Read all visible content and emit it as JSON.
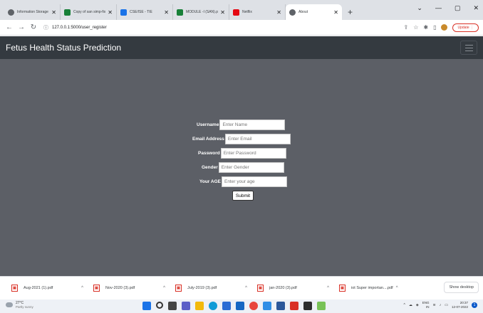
{
  "browser": {
    "tabs": [
      {
        "label": "Information Storage a",
        "color": "#5f6368",
        "active": false
      },
      {
        "label": "Copy of san simp-fix",
        "color": "#188038",
        "active": false
      },
      {
        "label": "CSE/ISE - TIE",
        "color": "#1a73e8",
        "active": false
      },
      {
        "label": "MODULE -I (SAN).pdf",
        "color": "#188038",
        "active": false
      },
      {
        "label": "Netflix",
        "color": "#e50914",
        "active": false
      },
      {
        "label": "About",
        "color": "#5f6368",
        "active": true
      }
    ],
    "url": "127.0.0.1:5000/user_register",
    "update_label": "Update"
  },
  "app": {
    "brand": "Fetus Health Status Prediction"
  },
  "form": {
    "fields": [
      {
        "label": "Username",
        "placeholder": "Enter Name"
      },
      {
        "label": "Email Address",
        "placeholder": "Enter Email"
      },
      {
        "label": "Password",
        "placeholder": "Enter Password"
      },
      {
        "label": "Gender",
        "placeholder": "Enter Gender"
      },
      {
        "label": "Your AGE",
        "placeholder": "Enter your age"
      }
    ],
    "submit_label": "Submit"
  },
  "downloads": {
    "items": [
      "Aug-2021 (1).pdf",
      "Nov-2020 (3).pdf",
      "July-2019 (3).pdf",
      "jan-2020 (3).pdf",
      "iot Super importan....pdf"
    ],
    "show_all_label": "Show desktop"
  },
  "taskbar": {
    "weather_temp": "27°C",
    "weather_desc": "Partly sunny",
    "lang": "ENG",
    "lang_region": "IN",
    "time": "20:37",
    "date": "12-07-2022",
    "notifications": "1"
  },
  "colors": {
    "navbar": "#343a40",
    "content_bg": "#5c5f66"
  }
}
